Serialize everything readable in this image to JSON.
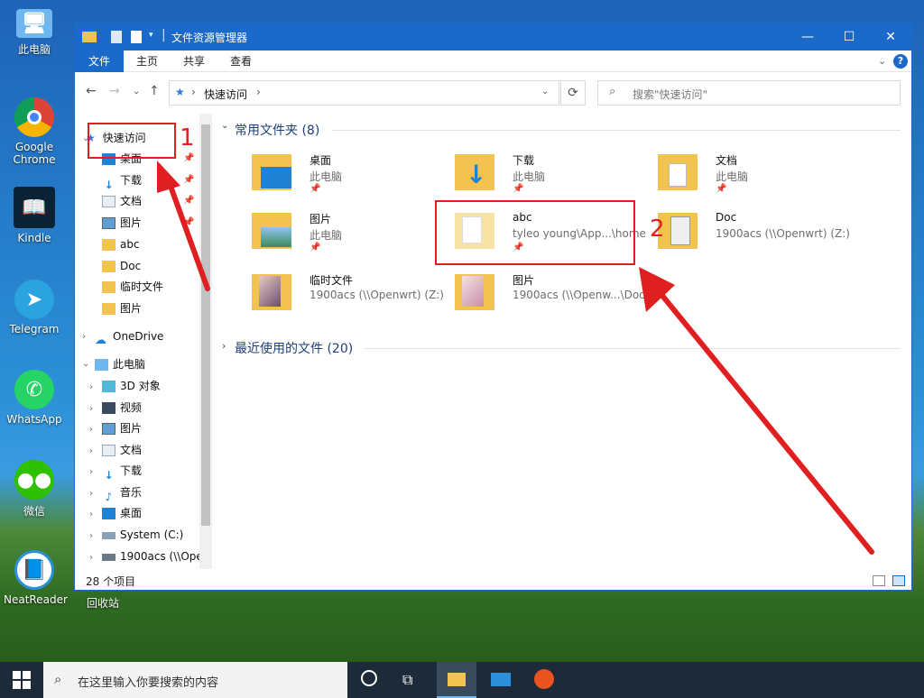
{
  "desktop": {
    "icons": [
      {
        "label": "此电脑",
        "icon": "computer-icon"
      },
      {
        "label": "Google Chrome",
        "icon": "chrome-icon"
      },
      {
        "label": "Kindle",
        "icon": "kindle-icon"
      },
      {
        "label": "Telegram",
        "icon": "telegram-icon"
      },
      {
        "label": "WhatsApp",
        "icon": "whatsapp-icon"
      },
      {
        "label": "微信",
        "icon": "wechat-icon"
      },
      {
        "label": "NeatReader",
        "icon": "neatreader-icon"
      },
      {
        "label": "回收站",
        "icon": "recycle-bin-icon"
      }
    ]
  },
  "window": {
    "title": "文件资源管理器",
    "ribbon_tabs": [
      "文件",
      "主页",
      "共享",
      "查看"
    ],
    "address": {
      "path": "快速访问",
      "separator": "›"
    },
    "search_placeholder": "搜索\"快速访问\"",
    "controls": {
      "minimize": "—",
      "maximize": "☐",
      "close": "✕"
    }
  },
  "nav": {
    "quick_access": "快速访问",
    "quick_items": [
      "桌面",
      "下载",
      "文档",
      "图片",
      "abc",
      "Doc",
      "临时文件",
      "图片"
    ],
    "onedrive": "OneDrive",
    "this_pc": "此电脑",
    "pc_items": [
      "3D 对象",
      "视频",
      "图片",
      "文档",
      "下载",
      "音乐",
      "桌面",
      "System (C:)",
      "1900acs (\\\\Ope"
    ]
  },
  "content": {
    "frequent_header": "常用文件夹 (8)",
    "recent_header": "最近使用的文件 (20)",
    "tiles": [
      {
        "name": "桌面",
        "sub": "此电脑",
        "pinned": true
      },
      {
        "name": "下载",
        "sub": "此电脑",
        "pinned": true
      },
      {
        "name": "文档",
        "sub": "此电脑",
        "pinned": true
      },
      {
        "name": "图片",
        "sub": "此电脑",
        "pinned": true
      },
      {
        "name": "abc",
        "sub": "tyleo young\\App...\\home",
        "pinned": true
      },
      {
        "name": "Doc",
        "sub": "1900acs (\\\\Openwrt) (Z:)",
        "pinned": false
      },
      {
        "name": "临时文件",
        "sub": "1900acs (\\\\Openwrt) (Z:)",
        "pinned": false
      },
      {
        "name": "图片",
        "sub": "1900acs (\\\\Openw...\\Doc",
        "pinned": false
      }
    ]
  },
  "status": {
    "items_count": "28 个项目"
  },
  "taskbar": {
    "search_placeholder": "在这里输入你要搜索的内容"
  },
  "annotations": {
    "label_1": "1",
    "label_2": "2"
  },
  "colors": {
    "accent": "#1b6ac9",
    "annotation_red": "#e02020",
    "folder_yellow": "#f2c34e"
  }
}
